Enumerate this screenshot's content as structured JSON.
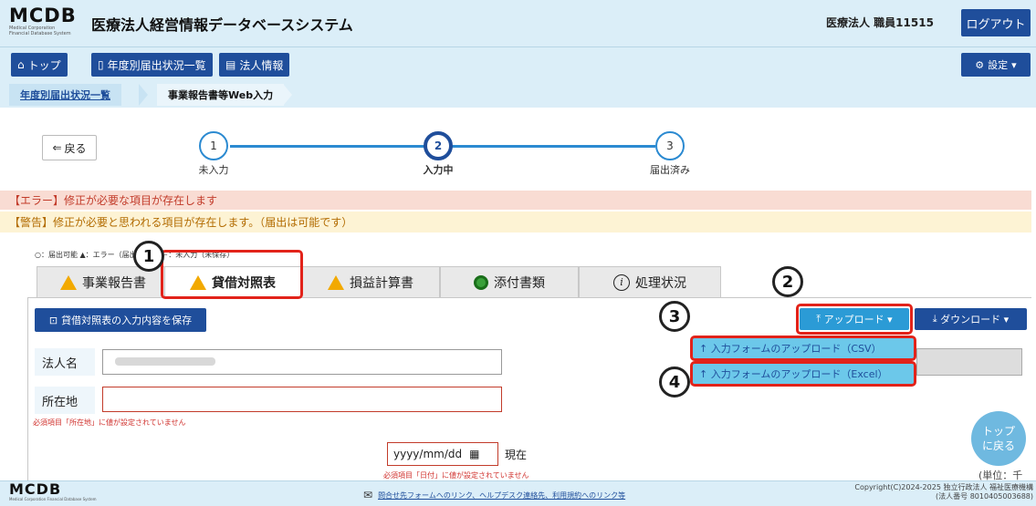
{
  "header": {
    "logo_text": "MCDB",
    "logo_sub": "Medical Corporation Financial Database System",
    "system_name": "医療法人経営情報データベースシステム",
    "user_label": "医療法人 職員11515",
    "logout_label": "ログアウト"
  },
  "nav": {
    "top_label": "トップ",
    "yearly_label": "年度別届出状況一覧",
    "corp_label": "法人情報",
    "settings_label": "設定"
  },
  "breadcrumb": {
    "item1": "年度別届出状況一覧",
    "item2": "事業報告書等Web入力"
  },
  "stepper": {
    "back_label": "戻る",
    "steps": [
      {
        "num": "1",
        "label": "未入力"
      },
      {
        "num": "2",
        "label": "入力中"
      },
      {
        "num": "3",
        "label": "届出済み"
      }
    ]
  },
  "alerts": {
    "error": "【エラー】修正が必要な項目が存在します",
    "warning": "【警告】修正が必要と思われる項目が存在します。（届出は可能です）"
  },
  "legend_text": "○：届出可能 ▲：エラー（届出不可） －：未入力（未保存）",
  "tabs": [
    {
      "label": "事業報告書"
    },
    {
      "label": "貸借対照表"
    },
    {
      "label": "損益計算書"
    },
    {
      "label": "添付書類"
    },
    {
      "label": "処理状況"
    }
  ],
  "form": {
    "save_label": "貸借対照表の入力内容を保存",
    "upload_label": "アップロード",
    "download_label": "ダウンロード",
    "upload_csv": "↑ 入力フォームのアップロード（CSV）",
    "upload_excel": "↑ 入力フォームのアップロード（Excel）",
    "name_label": "法人名",
    "address_label": "所在地",
    "address_error": "必須項目「所在地」に値が設定されていません",
    "date_placeholder": "yyyy/mm/dd",
    "date_suffix": "現在",
    "date_error": "必須項目「日付」に値が設定されていません",
    "to_top_line1": "トップ",
    "to_top_line2": "に戻る",
    "unit": "(単位：千円)"
  },
  "footer": {
    "logo_text": "MCDB",
    "logo_sub": "Medical Corporation Financial Database System",
    "links": "問合せ先フォームへのリンク、ヘルプデスク連絡先、利用規約へのリンク等",
    "copyright": "Copyright(C)2024-2025 独立行政法人 福祉医療機構",
    "corp_number": "(法人番号 8010405003688)"
  },
  "annotations": [
    "1",
    "2",
    "3",
    "4"
  ],
  "colors": {
    "primary": "#1f4e9b",
    "header_bg": "#dbeef8",
    "highlight": "#e2231a",
    "upload": "#2b9bd6"
  }
}
